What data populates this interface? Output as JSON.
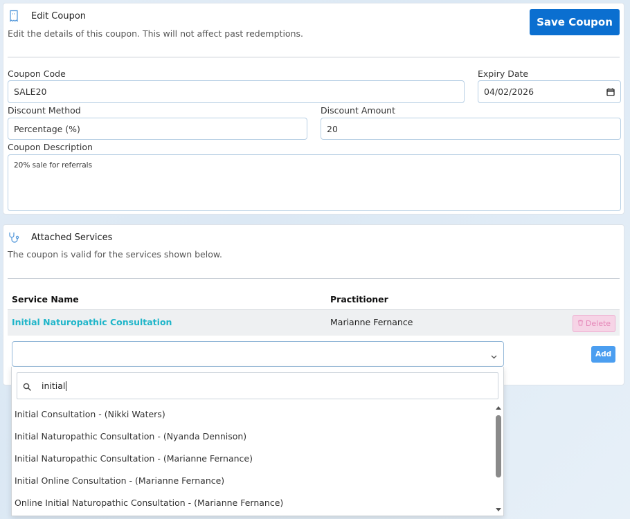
{
  "coupon_card": {
    "title": "Edit Coupon",
    "subtitle": "Edit the details of this coupon. This will not affect past redemptions.",
    "save_label": "Save Coupon",
    "fields": {
      "code_label": "Coupon Code",
      "code_value": "SALE20",
      "expiry_label": "Expiry Date",
      "expiry_value": "04/02/2026",
      "method_label": "Discount Method",
      "method_value": "Percentage (%)",
      "amount_label": "Discount Amount",
      "amount_value": "20",
      "description_label": "Coupon Description",
      "description_value": "20% sale for referrals"
    }
  },
  "services_card": {
    "title": "Attached Services",
    "subtitle": "The coupon is valid for the services shown below.",
    "columns": [
      "Service Name",
      "Practitioner"
    ],
    "rows": [
      {
        "service": "Initial Naturopathic Consultation",
        "practitioner": "Marianne Fernance"
      }
    ],
    "delete_label": "Delete",
    "add_label": "Add"
  },
  "dropdown": {
    "search_value": "initial",
    "options": [
      "Initial Consultation - (Nikki Waters)",
      "Initial Naturopathic Consultation - (Nyanda Dennison)",
      "Initial Naturopathic Consultation - (Marianne Fernance)",
      "Initial Online Consultation - (Marianne Fernance)",
      "Online Initial Naturopathic Consultation - (Marianne Fernance)"
    ]
  },
  "icons": {
    "coupon": "ticket-icon",
    "services": "stethoscope-icon",
    "search": "search-icon",
    "calendar": "calendar-icon",
    "chevron": "chevron-down-icon",
    "trash": "trash-icon"
  },
  "colors": {
    "primary": "#0b6fd0",
    "link": "#1fb5c9",
    "delete_bg": "#f6d4e6",
    "add_bg": "#4b9ef0",
    "icon": "#4a92d8"
  }
}
